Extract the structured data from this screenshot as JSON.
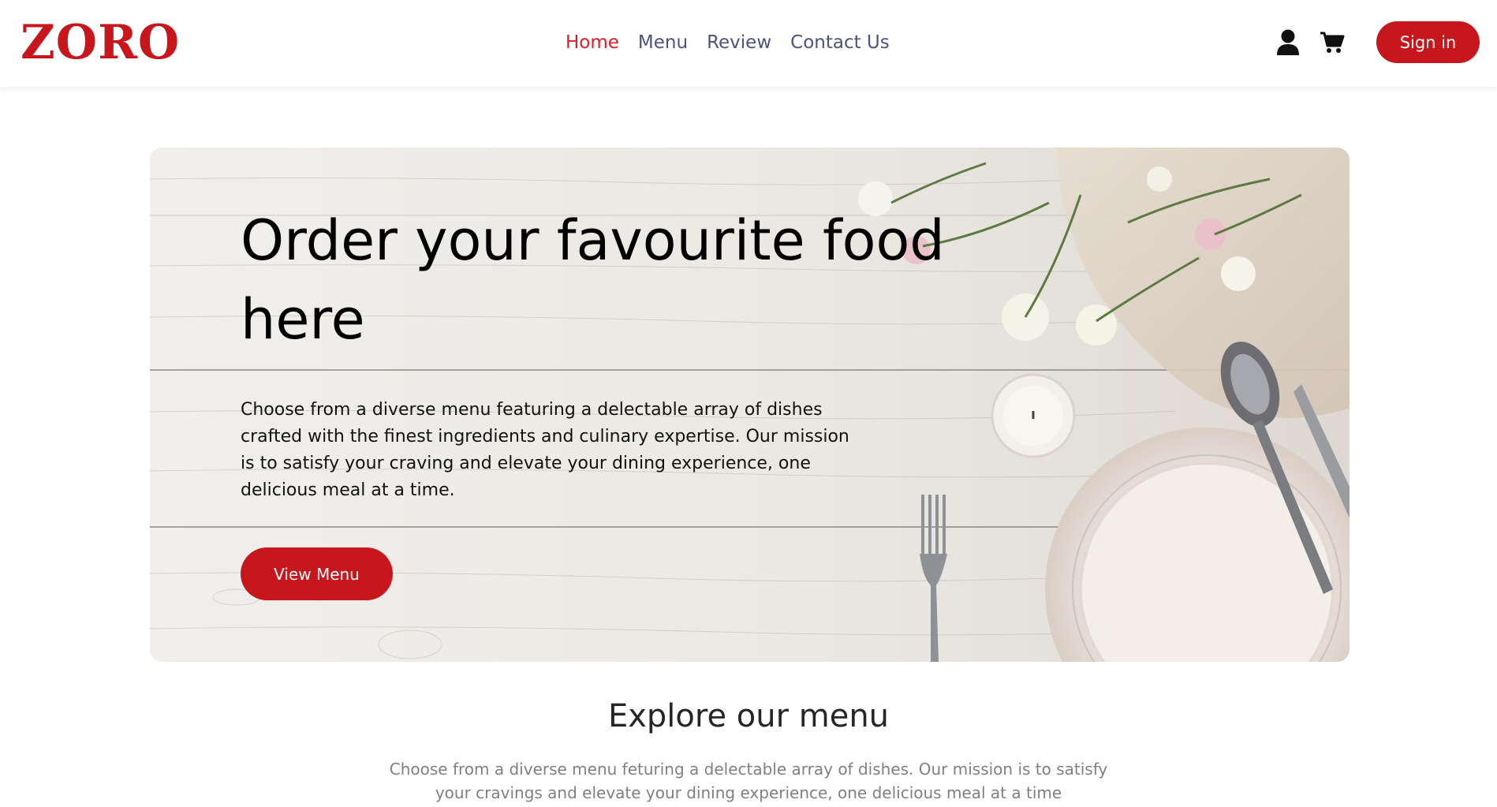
{
  "header": {
    "logo": "ZORO",
    "nav": [
      {
        "label": "Home",
        "active": true
      },
      {
        "label": "Menu",
        "active": false
      },
      {
        "label": "Review",
        "active": false
      },
      {
        "label": "Contact Us",
        "active": false
      }
    ],
    "icons": [
      "user-icon",
      "cart-icon"
    ],
    "signin_label": "Sign in"
  },
  "hero": {
    "title": "Order your favourite food here",
    "description": "Choose from a diverse menu featuring a delectable array of dishes crafted with the finest ingredients and culinary expertise. Our mission is to satisfy your craving and elevate your dining experience, one delicious meal at a time.",
    "button_label": "View Menu"
  },
  "explore": {
    "title": "Explore our menu",
    "description": "Choose from a diverse menu feturing a delectable array of dishes. Our mission is to satisfy your cravings and elevate your dining experience, one delicious meal at a time"
  },
  "colors": {
    "brand": "#c8161d",
    "nav_text": "#49557e",
    "nav_active": "#d61f26",
    "muted_text": "#808080"
  }
}
